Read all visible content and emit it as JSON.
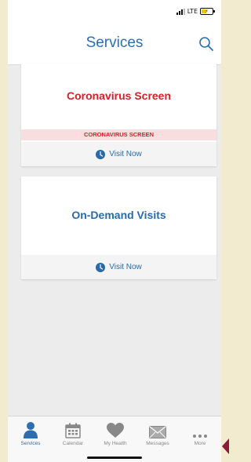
{
  "status_bar": {
    "network": "LTE"
  },
  "header": {
    "title": "Services"
  },
  "cards": [
    {
      "title": "Coronavirus Screen",
      "banner": "CORONAVIRUS SCREEN",
      "action": "Visit Now"
    },
    {
      "title": "On-Demand Visits",
      "action": "Visit Now"
    }
  ],
  "tabs": [
    {
      "label": "Services",
      "icon": "person-icon",
      "active": true
    },
    {
      "label": "Calendar",
      "icon": "calendar-icon"
    },
    {
      "label": "My Health",
      "icon": "heart-icon"
    },
    {
      "label": "Messages",
      "icon": "envelope-icon"
    },
    {
      "label": "More",
      "icon": "more-dots-icon"
    }
  ],
  "colors": {
    "primary": "#2c6eb0",
    "alert": "#d81f26",
    "alert_bg": "#f8dede",
    "background": "#ececec",
    "frame": "#f3ebcf"
  }
}
